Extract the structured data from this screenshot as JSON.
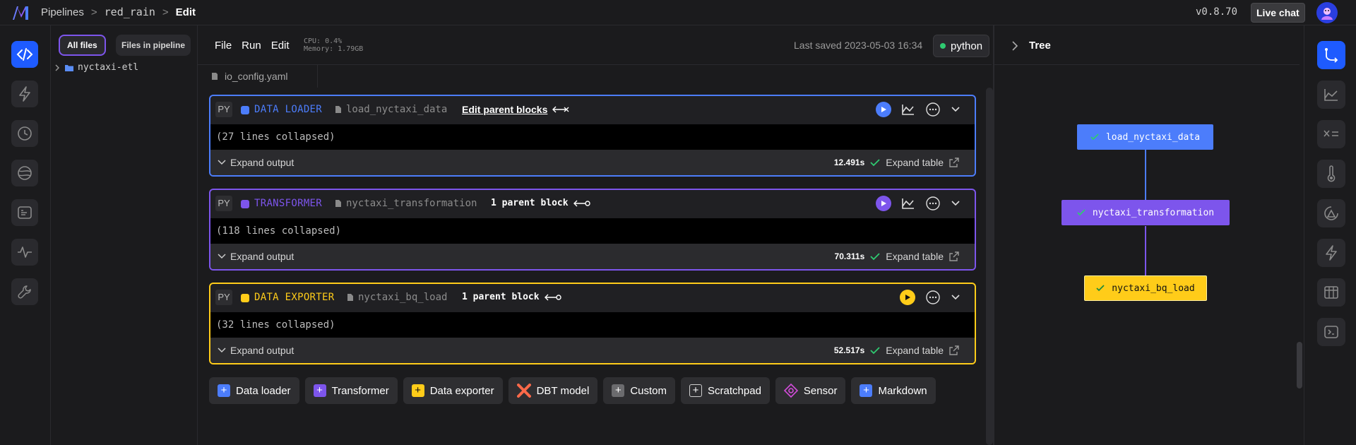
{
  "topbar": {
    "breadcrumbs": [
      "Pipelines",
      "red_rain",
      "Edit"
    ],
    "separator": ">",
    "version": "v0.8.70",
    "live_chat": "Live chat"
  },
  "left_rail": {
    "items": [
      "code-icon",
      "trigger-icon",
      "history-icon",
      "globe-icon",
      "terminal-icon",
      "monitor-icon",
      "settings-icon"
    ]
  },
  "files": {
    "tab_all": "All files",
    "tab_pipeline": "Files in pipeline",
    "items": [
      {
        "label": "nyctaxi-etl"
      }
    ]
  },
  "editor": {
    "menu": [
      "File",
      "Run",
      "Edit"
    ],
    "cpu": "CPU: 0.4%",
    "memory": "Memory: 1.79GB",
    "last_saved": "Last saved 2023-05-03 16:34",
    "kernel": "python",
    "open_file": "io_config.yaml"
  },
  "blocks": [
    {
      "lang": "PY",
      "type": "DATA LOADER",
      "file": "load_nyctaxi_data",
      "parent": "Edit parent blocks",
      "collapsed": "(27 lines collapsed)",
      "expand_output": "Expand output",
      "time": "12.491s",
      "expand_table": "Expand table",
      "color": "#4c7dfb"
    },
    {
      "lang": "PY",
      "type": "TRANSFORMER",
      "file": "nyctaxi_transformation",
      "parent": "1 parent block",
      "collapsed": "(118 lines collapsed)",
      "expand_output": "Expand output",
      "time": "70.311s",
      "expand_table": "Expand table",
      "color": "#7d55ec"
    },
    {
      "lang": "PY",
      "type": "DATA EXPORTER",
      "file": "nyctaxi_bq_load",
      "parent": "1 parent block",
      "collapsed": "(32 lines collapsed)",
      "expand_output": "Expand output",
      "time": "52.517s",
      "expand_table": "Expand table",
      "color": "#ffcc19"
    }
  ],
  "add_blocks": [
    {
      "label": "Data loader",
      "color": "#4c7dfb"
    },
    {
      "label": "Transformer",
      "color": "#7d55ec"
    },
    {
      "label": "Data exporter",
      "color": "#ffcc19"
    },
    {
      "label": "DBT model",
      "color": "#fc6949"
    },
    {
      "label": "Custom",
      "color": "#6b6b6e"
    },
    {
      "label": "Scratchpad",
      "color": "#2e2e31"
    },
    {
      "label": "Sensor",
      "color": "#d24cda"
    },
    {
      "label": "Markdown",
      "color": "#4c7dfb"
    }
  ],
  "tree": {
    "title": "Tree",
    "nodes": [
      {
        "label": "load_nyctaxi_data",
        "color": "#4c7dfb"
      },
      {
        "label": "nyctaxi_transformation",
        "color": "#7d55ec"
      },
      {
        "label": "nyctaxi_bq_load",
        "color": "#ffcc19"
      }
    ]
  },
  "right_rail": {
    "items": [
      "tree-icon",
      "chart-icon",
      "variables-icon",
      "thermometer-icon",
      "sensor-icon",
      "trigger-icon",
      "table-icon",
      "terminal-icon"
    ]
  }
}
